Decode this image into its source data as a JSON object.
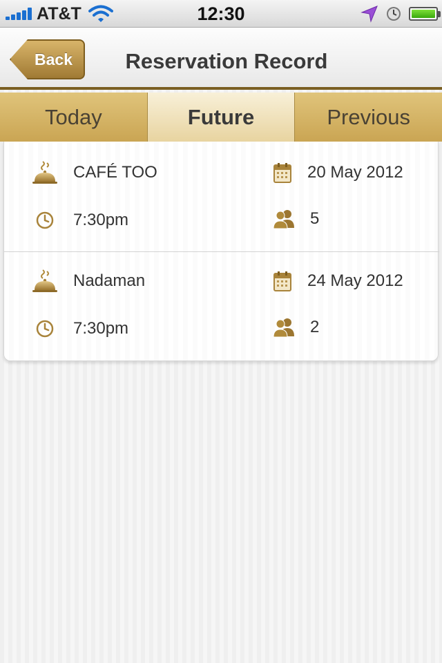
{
  "status_bar": {
    "carrier": "AT&T",
    "time": "12:30",
    "icons": [
      "signal-icon",
      "wifi-icon",
      "location-arrow-icon",
      "alarm-clock-icon",
      "battery-icon"
    ]
  },
  "nav": {
    "back_label": "Back",
    "title": "Reservation Record"
  },
  "tabs": [
    {
      "label": "Today",
      "active": false
    },
    {
      "label": "Future",
      "active": true
    },
    {
      "label": "Previous",
      "active": false
    }
  ],
  "reservations": [
    {
      "restaurant": "CAFÉ TOO",
      "date": "20 May 2012",
      "time": "7:30pm",
      "guests": "5"
    },
    {
      "restaurant": "Nadaman",
      "date": "24 May 2012",
      "time": "7:30pm",
      "guests": "2"
    }
  ],
  "icons": {
    "restaurant": "cloche-icon",
    "date": "calendar-icon",
    "time": "clock-icon",
    "guests": "people-icon"
  },
  "colors": {
    "accent_gold": "#b08a3a",
    "tab_gold": "#d9bb6f",
    "nav_border": "#7a5f22",
    "text": "#333333"
  }
}
